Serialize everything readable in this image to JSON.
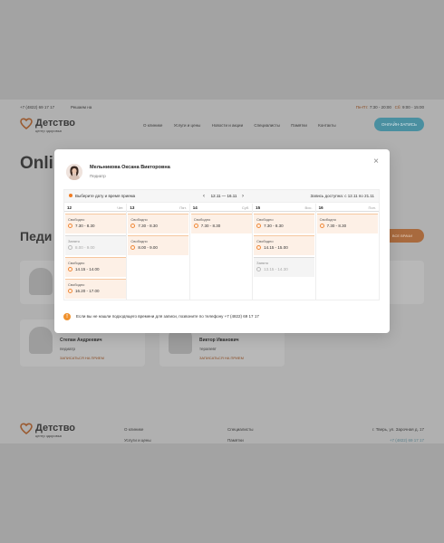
{
  "site": {
    "topbar": {
      "phone": "+7 (4822) 69 17 17",
      "rating": "Решаем на",
      "hours_prefix": "Пн-Пт:",
      "hours_weekday": "7:30 - 20:00",
      "hours_sat_prefix": "Сб:",
      "hours_sat": "9:00 - 15:00"
    },
    "logo": {
      "title": "Детство",
      "subtitle": "центр здоровья"
    },
    "nav": [
      "О клинике",
      "Услуги и цены",
      "Новости и акции",
      "Специалисты",
      "Памятки",
      "Контакты"
    ],
    "cta": "ОНЛАЙН-ЗАПИСЬ",
    "hero_title": "Onli",
    "section_title": "Педи",
    "section_btn": "ВСЕ ВРАЧИ",
    "cards": [
      {
        "name": "Степан Андреевич",
        "spec": "педиатр",
        "link": "ЗАПИСАТЬСЯ НА ПРИЕМ"
      },
      {
        "name": "Виктор Иванович",
        "spec": "терапевт",
        "link": "ЗАПИСАТЬСЯ НА ПРИЕМ"
      }
    ],
    "footer": {
      "col1": [
        "О клинике",
        "Услуги и цены"
      ],
      "col2": [
        "Специалисты",
        "Памятки"
      ],
      "address": "г. Тверь, ул. Зарочная д. 17",
      "phone": "+7 (4822) 69 17 17"
    }
  },
  "modal": {
    "doctor_name": "Мельникова Оксана Викторовна",
    "doctor_spec": "Педиатр",
    "hint": "Выберите дату и время приема",
    "range": "12.11 — 16.11",
    "available": "Запись доступна: с 12.11 по 21.11",
    "days": [
      {
        "num": "12",
        "dow": "Чет.",
        "slots": [
          {
            "status": "Свободно",
            "time": "7.30 - 8.30",
            "busy": false
          },
          {
            "status": "Занято",
            "time": "8.00 - 9.00",
            "busy": true
          },
          {
            "status": "Свободно",
            "time": "14.15 - 14.00",
            "busy": false
          },
          {
            "status": "Свободно",
            "time": "16.20 - 17.00",
            "busy": false
          }
        ]
      },
      {
        "num": "13",
        "dow": "Пят.",
        "slots": [
          {
            "status": "Свободно",
            "time": "7.30 - 8.30",
            "busy": false
          },
          {
            "status": "Свободно",
            "time": "8.00 - 9.00",
            "busy": false
          }
        ]
      },
      {
        "num": "14",
        "dow": "Суб.",
        "slots": [
          {
            "status": "Свободно",
            "time": "7.30 - 8.30",
            "busy": false
          }
        ]
      },
      {
        "num": "15",
        "dow": "Вос.",
        "slots": [
          {
            "status": "Свободно",
            "time": "7.30 - 8.30",
            "busy": false
          },
          {
            "status": "Свободно",
            "time": "14.15 - 15.00",
            "busy": false
          },
          {
            "status": "Занято",
            "time": "13.15 - 14.30",
            "busy": true
          }
        ]
      },
      {
        "num": "16",
        "dow": "Пон.",
        "slots": [
          {
            "status": "Свободно",
            "time": "7.30 - 8.30",
            "busy": false
          }
        ]
      }
    ],
    "info": "Если вы не нашли подходящего времени для записи, позвоните по телефону +7 (4822) 69 17 17"
  }
}
